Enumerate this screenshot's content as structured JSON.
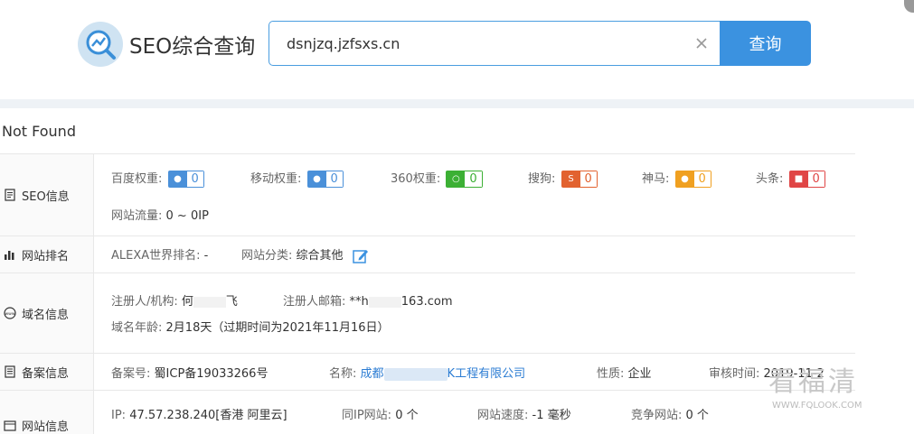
{
  "header": {
    "logo_text": "SEO综合查询",
    "search_value": "dsnjzq.jzfsxs.cn",
    "search_button": "查询",
    "icons": {
      "logo": "seo-magnifier-chart-icon",
      "clear": "close-icon"
    }
  },
  "status": "Not Found",
  "seo": {
    "label": "SEO信息",
    "weights": [
      {
        "name": "百度权重:",
        "value": "0",
        "icon": "baidu-paw-icon",
        "color": "#4a90d9"
      },
      {
        "name": "移动权重:",
        "value": "0",
        "icon": "baidu-mobile-paw-icon",
        "color": "#4a90d9"
      },
      {
        "name": "360权重:",
        "value": "0",
        "icon": "360-icon",
        "color": "#3cb034"
      },
      {
        "name": "搜狗:",
        "value": "0",
        "icon": "sogou-icon",
        "color": "#e2622f"
      },
      {
        "name": "神马:",
        "value": "0",
        "icon": "shenma-icon",
        "color": "#f0a020"
      },
      {
        "name": "头条:",
        "value": "0",
        "icon": "toutiao-icon",
        "color": "#e04545"
      }
    ],
    "traffic_label": "网站流量:",
    "traffic_value": "0 ~ 0IP"
  },
  "rank": {
    "label": "网站排名",
    "alexa_label": "ALEXA世界排名:",
    "alexa_value": "-",
    "category_label": "网站分类:",
    "category_value": "综合其他"
  },
  "domain": {
    "label": "域名信息",
    "registrant_label": "注册人/机构:",
    "registrant_value": "何",
    "registrant_value_tail": "飞",
    "email_label": "注册人邮箱:",
    "email_value": "**h",
    "email_value_tail": "163.com",
    "age_label": "域名年龄:",
    "age_value": "2月18天（过期时间为2021年11月16日）"
  },
  "icp": {
    "label": "备案信息",
    "number_label": "备案号:",
    "number_value": "蜀ICP备19033266号",
    "name_label": "名称:",
    "name_value_head": "成都",
    "name_value_tail": "K工程有限公司",
    "nature_label": "性质:",
    "nature_value": "企业",
    "audit_label": "审核时间:",
    "audit_value": "2019-11-2"
  },
  "site": {
    "label": "网站信息",
    "ip_label": "IP:",
    "ip_value": "47.57.238.240[香港 阿里云]",
    "same_ip_label": "同IP网站:",
    "same_ip_value": "0 个",
    "speed_label": "网站速度:",
    "speed_value": "-1 毫秒",
    "compete_label": "竞争网站:",
    "compete_value": "0 个"
  },
  "watermark": {
    "main": "看福清",
    "sub": "WWW.FQLOOK.COM"
  }
}
